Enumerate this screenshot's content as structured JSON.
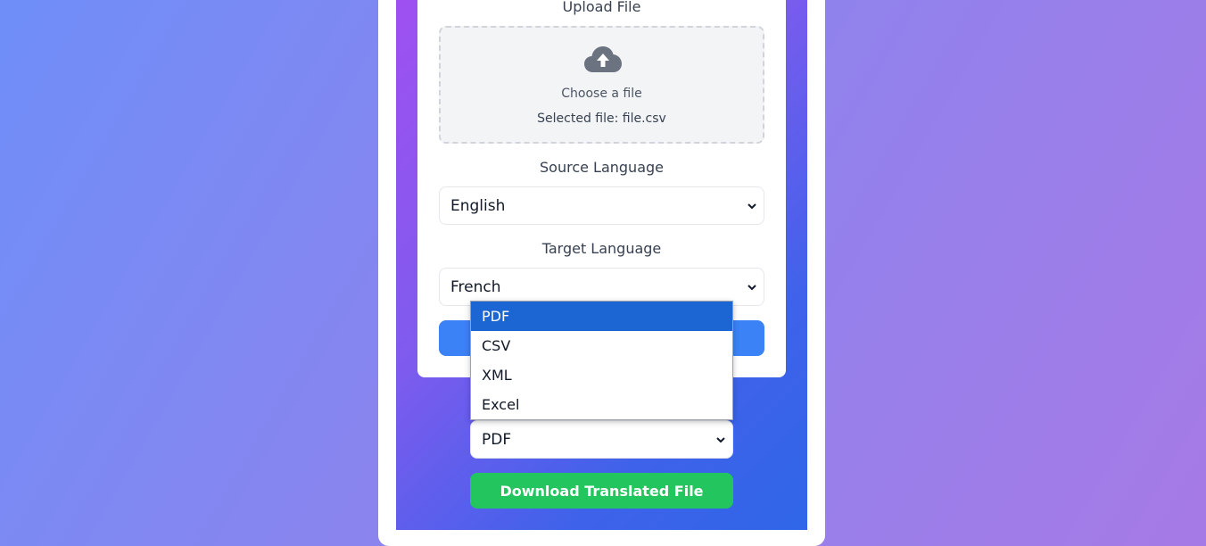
{
  "upload": {
    "label": "Upload File",
    "title": "Choose a file",
    "selected": "Selected file: file.csv"
  },
  "source": {
    "label": "Source Language",
    "value": "English"
  },
  "target": {
    "label": "Target Language",
    "value": "French"
  },
  "format": {
    "value": "PDF",
    "options": [
      "PDF",
      "CSV",
      "XML",
      "Excel"
    ]
  },
  "download": {
    "label": "Download Translated File"
  },
  "colors": {
    "translate_button": "#3b82f6",
    "download_button": "#22c55e",
    "dropdown_highlight": "#1c66d4"
  },
  "icons": {
    "upload": "cloud-upload-icon",
    "select": "chevron-down-icon"
  }
}
